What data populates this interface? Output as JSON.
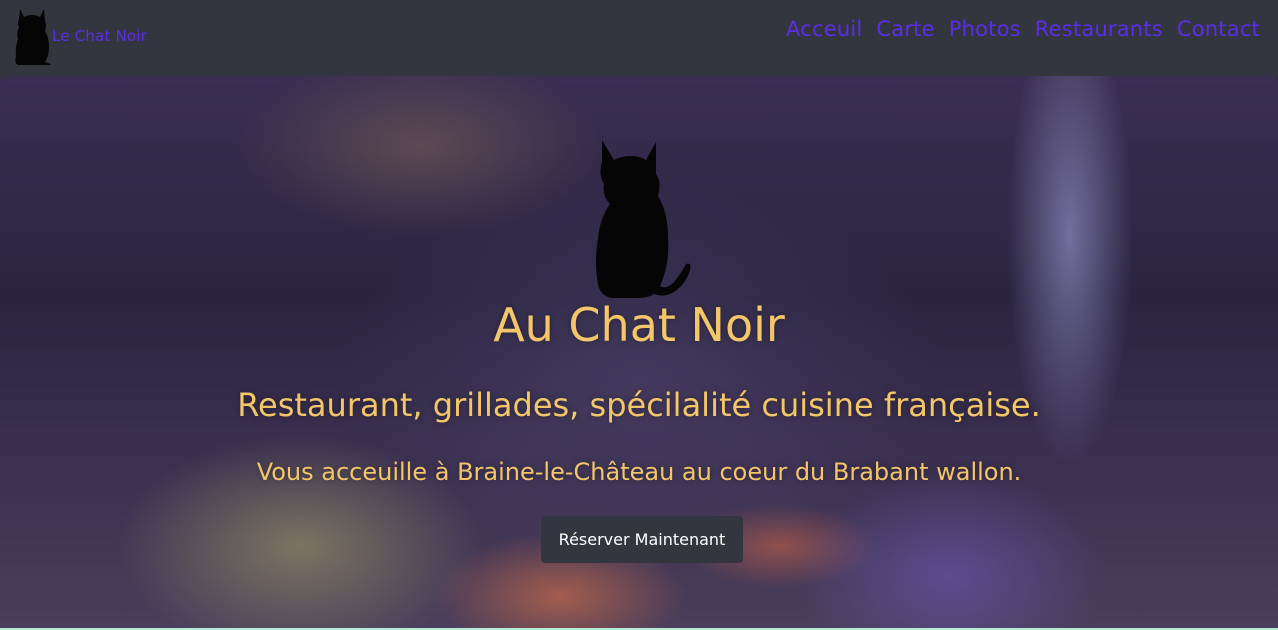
{
  "brand": {
    "name": "Le Chat Noir",
    "logo_icon": "black-cat-icon"
  },
  "nav": {
    "items": [
      {
        "label": "Acceuil"
      },
      {
        "label": "Carte"
      },
      {
        "label": "Photos"
      },
      {
        "label": "Restaurants"
      },
      {
        "label": "Contact"
      }
    ]
  },
  "hero": {
    "logo_icon": "black-cat-icon",
    "title": "Au Chat Noir",
    "subtitle": "Restaurant, grillades, spécilalité cuisine française.",
    "text": "Vous acceuille à Braine-le-Château au coeur du Brabant wallon.",
    "cta_label": "Réserver Maintenant"
  },
  "colors": {
    "navbar_bg": "#33363e",
    "nav_link": "#5b2ee6",
    "hero_text": "#f3c66a",
    "button_bg": "#33363e",
    "button_text": "#ffffff"
  }
}
